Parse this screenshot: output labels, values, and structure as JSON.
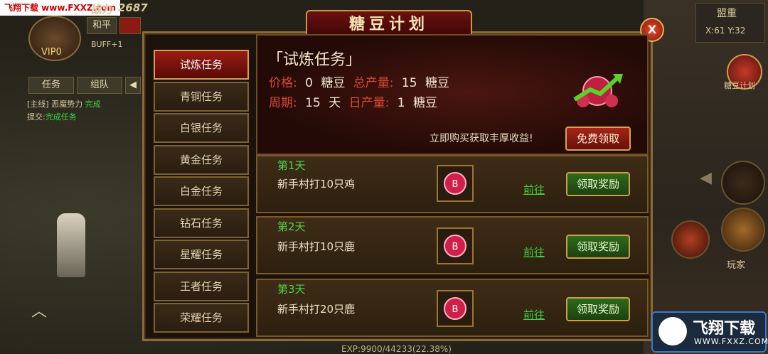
{
  "watermark": {
    "top_text": "飞翔下载 www.FXXZ.com",
    "logo_main": "飞翔下载",
    "logo_sub": "WWW.FXXZ.COM"
  },
  "hud": {
    "power_label": "战力",
    "power_value": "2687",
    "peace_button": "和平",
    "vip_label": "VIP0",
    "buff_label": "BUFF+1",
    "task_tab": "任务",
    "team_tab": "组队",
    "quest_line": "[主线] 恶魔势力",
    "quest_status": "完成",
    "submit_label": "提交:",
    "submit_target": "完成任务",
    "map_name": "盟重",
    "coords": "X:61 Y:32",
    "candy_plan_icon_label": "糖豆计划",
    "player_label": "玩家",
    "exp_text": "EXP:9900/44233(22.38%)"
  },
  "window": {
    "title": "糖豆计划",
    "close_label": "X"
  },
  "sidebar": {
    "items": [
      {
        "label": "试炼任务",
        "active": true
      },
      {
        "label": "青铜任务",
        "active": false
      },
      {
        "label": "白银任务",
        "active": false
      },
      {
        "label": "黄金任务",
        "active": false
      },
      {
        "label": "白金任务",
        "active": false
      },
      {
        "label": "钻石任务",
        "active": false
      },
      {
        "label": "星耀任务",
        "active": false
      },
      {
        "label": "王者任务",
        "active": false
      },
      {
        "label": "荣耀任务",
        "active": false
      }
    ]
  },
  "header": {
    "title": "「试炼任务」",
    "price_label": "价格:",
    "price_value": "0",
    "price_unit": "糖豆",
    "total_label": "总产量:",
    "total_value": "15",
    "total_unit": "糖豆",
    "cycle_label": "周期:",
    "cycle_value": "15",
    "cycle_unit": "天",
    "daily_label": "日产量:",
    "daily_value": "1",
    "daily_unit": "糖豆",
    "promo_text": "立即购买获取丰厚收益!",
    "free_button": "免费领取"
  },
  "days": [
    {
      "day": "第1天",
      "task": "新手村打10只鸡",
      "goto": "前往",
      "claim": "领取奖励"
    },
    {
      "day": "第2天",
      "task": "新手村打10只鹿",
      "goto": "前往",
      "claim": "领取奖励"
    },
    {
      "day": "第3天",
      "task": "新手村打20只鹿",
      "goto": "前往",
      "claim": "领取奖励"
    }
  ]
}
